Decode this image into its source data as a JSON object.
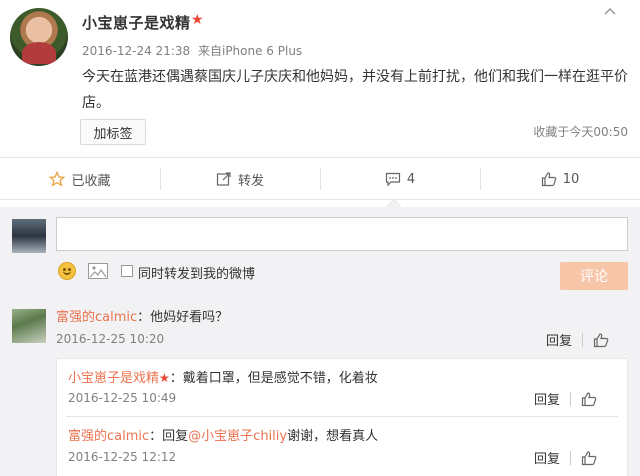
{
  "post": {
    "author": "小宝崽子是戏精",
    "vip_badge": "★",
    "date": "2016-12-24 21:38",
    "source_prefix": "来自",
    "source": "iPhone 6 Plus",
    "text": "今天在蓝港还偶遇蔡国庆儿子庆庆和他妈妈，并没有上前打扰，他们和我们一样在逛平价店。",
    "tag_button": "加标签",
    "favorited_time": "收藏于今天00:50"
  },
  "actions": {
    "favorite": "已收藏",
    "repost": "转发",
    "comments": "4",
    "likes": "10"
  },
  "composer": {
    "placeholder": "",
    "repost_option": "同时转发到我的微博",
    "submit": "评论"
  },
  "comments": [
    {
      "name": "富强的calmic",
      "text": "：他妈好看吗？",
      "time": "2016-12-25 10:20",
      "reply": "回复"
    }
  ],
  "replies": [
    {
      "name": "小宝崽子是戏精",
      "badge": "★",
      "text": "：戴着口罩，但是感觉不错，化着妆",
      "time": "2016-12-25 10:49",
      "reply": "回复"
    },
    {
      "name": "富强的calmic",
      "text_prefix": "：回复",
      "mention": "@小宝崽子chiliy",
      "text": "谢谢，想看真人",
      "time": "2016-12-25 12:12",
      "reply": "回复"
    }
  ],
  "colors": {
    "accent": "#eb7350",
    "submit_disabled": "#f7c6a8",
    "muted": "#808080"
  }
}
